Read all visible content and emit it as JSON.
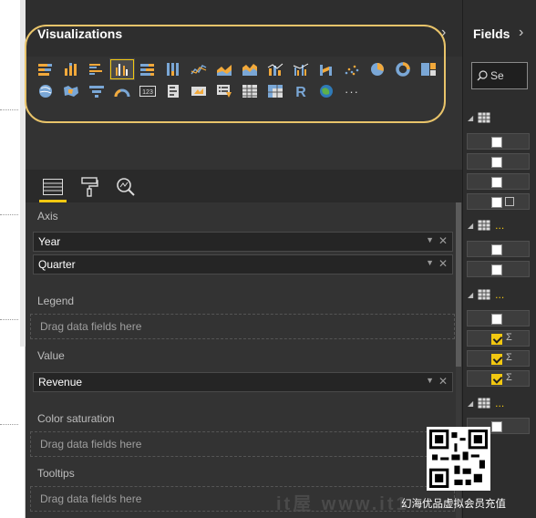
{
  "visualizations": {
    "title": "Visualizations",
    "collapse_icon": "chevron-right-icon",
    "row1": [
      "stacked-bar-icon",
      "stacked-column-icon",
      "clustered-bar-icon",
      "clustered-column-icon",
      "100-stacked-bar-icon",
      "100-stacked-column-icon",
      "line-chart-icon",
      "area-chart-icon",
      "stacked-area-icon",
      "line-column-icon",
      "line-clustered-column-icon",
      "ribbon-chart-icon",
      "scatter-chart-icon",
      "pie-chart-icon",
      "donut-chart-icon",
      "treemap-icon"
    ],
    "row2": [
      "map-icon",
      "filled-map-icon",
      "funnel-icon",
      "gauge-icon",
      "card-icon",
      "multi-row-card-icon",
      "kpi-icon",
      "slicer-icon",
      "table-icon",
      "matrix-icon",
      "r-visual-icon",
      "globe-map-icon",
      "more-icon"
    ],
    "selected": "clustered-column-icon",
    "r_label": "R",
    "card_label": "123",
    "more_label": "···"
  },
  "tabs": [
    {
      "name": "fields-tab-icon",
      "active": true
    },
    {
      "name": "format-paint-roller-icon",
      "active": false
    },
    {
      "name": "analytics-magnifier-icon",
      "active": false
    }
  ],
  "wells": {
    "axis_label": "Axis",
    "axis_fields": [
      "Year",
      "Quarter"
    ],
    "legend_label": "Legend",
    "legend_placeholder": "Drag data fields here",
    "value_label": "Value",
    "value_fields": [
      "Revenue"
    ],
    "color_saturation_label": "Color saturation",
    "color_saturation_placeholder": "Drag data fields here",
    "tooltips_label": "Tooltips",
    "tooltips_placeholder": "Drag data fields here"
  },
  "fields": {
    "title": "Fields",
    "search_placeholder": "Se",
    "table_more": "...",
    "rows": [
      {
        "checked": false,
        "type": "plain"
      },
      {
        "checked": false,
        "type": "plain"
      },
      {
        "checked": false,
        "type": "plain"
      },
      {
        "checked": false,
        "type": "calendar"
      },
      {
        "checked": false,
        "type": "plain"
      },
      {
        "checked": false,
        "type": "plain"
      },
      {
        "checked": false,
        "type": "plain"
      },
      {
        "checked": true,
        "type": "sigma"
      },
      {
        "checked": true,
        "type": "sigma"
      },
      {
        "checked": true,
        "type": "sigma"
      },
      {
        "checked": false,
        "type": "plain"
      }
    ],
    "sigma": "Σ"
  },
  "watermark": {
    "site": "it屋 www.it1",
    "caption": "幻海优品虚拟会员充值"
  },
  "colors": {
    "accent": "#f2c811",
    "highlight_ring": "#e9c46a",
    "pane_bg": "#333333",
    "fields_bg": "#2d2d2d"
  }
}
